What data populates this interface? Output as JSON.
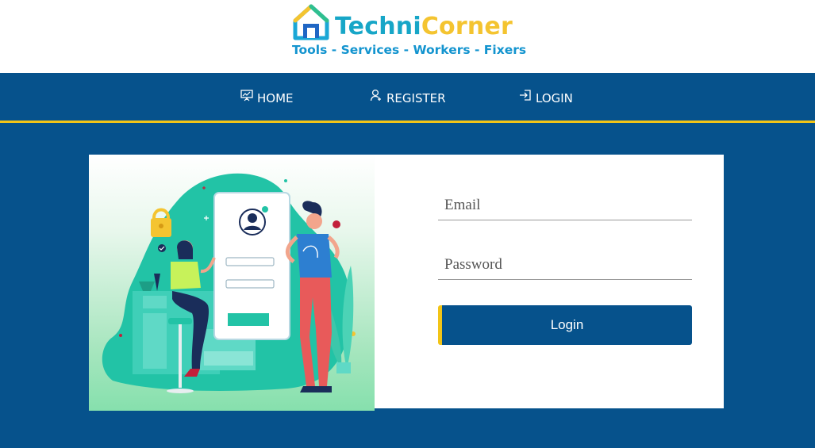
{
  "brand": {
    "name_part1": "Techni",
    "name_part2": "Corner",
    "tagline": "Tools - Services - Workers - Fixers",
    "logo_icon": "house-icon"
  },
  "nav": {
    "items": [
      {
        "label": "HOME",
        "icon": "presentation-icon"
      },
      {
        "label": "REGISTER",
        "icon": "user-add-icon"
      },
      {
        "label": "LOGIN",
        "icon": "sign-in-icon"
      }
    ]
  },
  "login_form": {
    "email_placeholder": "Email",
    "password_placeholder": "Password",
    "submit_label": "Login"
  },
  "colors": {
    "navy": "#06528c",
    "accent_yellow": "#f2c417",
    "brand_teal": "#17a6c7",
    "illustration_green": "#22c3a6"
  }
}
